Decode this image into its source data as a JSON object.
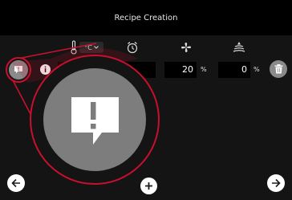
{
  "window": {
    "title": "Recipe Creation"
  },
  "header": {
    "temperature_unit": "°C",
    "icons": [
      "thermometer-icon",
      "timer-icon",
      "fan-icon",
      "humidity-icon"
    ]
  },
  "step_row": {
    "fan_value": "20",
    "fan_unit": "%",
    "humidity_value": "0",
    "humidity_unit": "%"
  },
  "footer": {
    "icons": [
      "back-arrow-icon",
      "add-icon",
      "forward-arrow-icon"
    ]
  },
  "highlight": {
    "subject": "comment-alert-icon",
    "accent_color": "#c8102e"
  },
  "colors": {
    "background": "#141414",
    "titlebar": "#000000",
    "button_grey": "#8a8a8a",
    "zoom_fill": "#7d7d7d"
  }
}
